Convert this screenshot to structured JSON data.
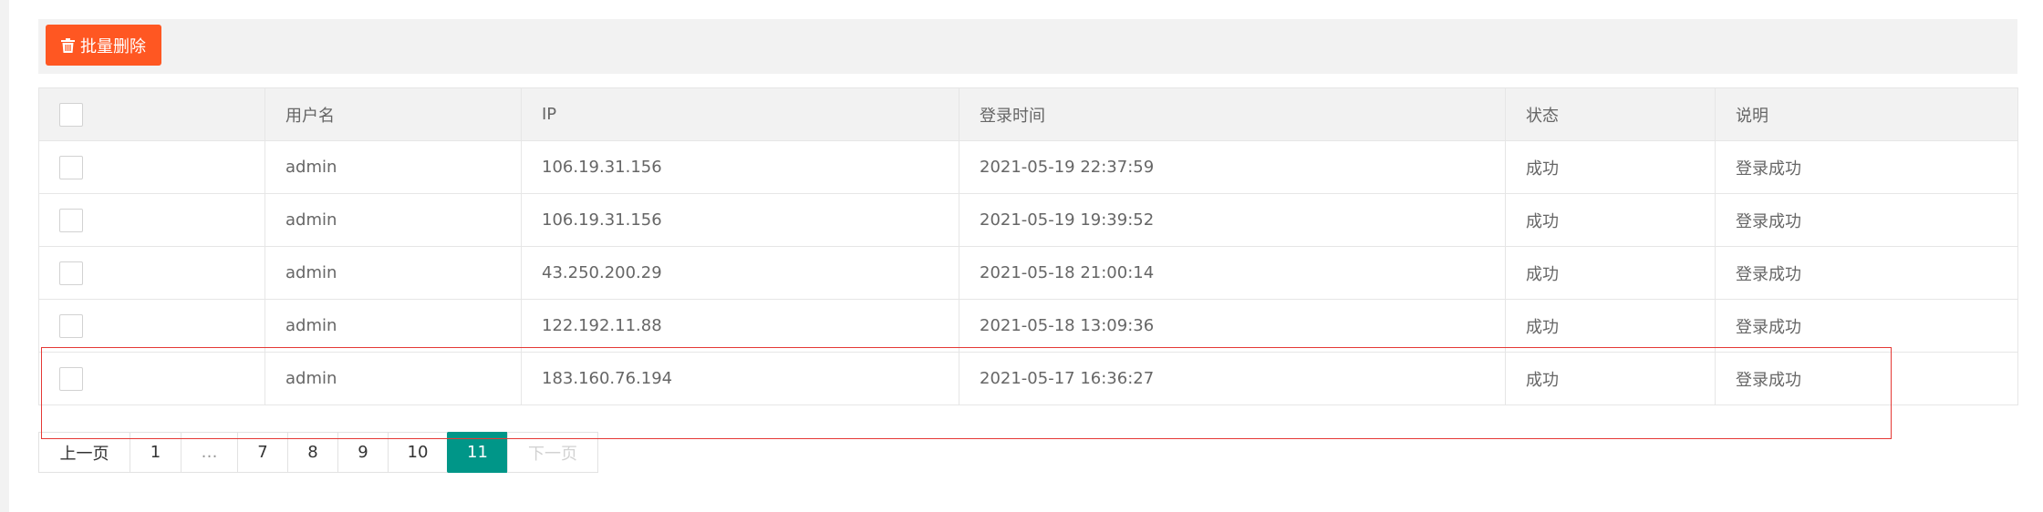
{
  "toolbar": {
    "batch_delete_label": "批量删除",
    "batch_delete_icon": "trash-icon",
    "batch_delete_color": "#ff5722"
  },
  "table": {
    "headers": [
      "用户名",
      "IP",
      "登录时间",
      "状态",
      "说明"
    ],
    "rows": [
      {
        "username": "admin",
        "ip": "106.19.31.156",
        "login_time": "2021-05-19 22:37:59",
        "status": "成功",
        "description": "登录成功"
      },
      {
        "username": "admin",
        "ip": "106.19.31.156",
        "login_time": "2021-05-19 19:39:52",
        "status": "成功",
        "description": "登录成功"
      },
      {
        "username": "admin",
        "ip": "43.250.200.29",
        "login_time": "2021-05-18 21:00:14",
        "status": "成功",
        "description": "登录成功"
      },
      {
        "username": "admin",
        "ip": "122.192.11.88",
        "login_time": "2021-05-18 13:09:36",
        "status": "成功",
        "description": "登录成功"
      },
      {
        "username": "admin",
        "ip": "183.160.76.194",
        "login_time": "2021-05-17 16:36:27",
        "status": "成功",
        "description": "登录成功"
      }
    ]
  },
  "pagination": {
    "prev_label": "上一页",
    "first_page": "1",
    "ellipsis": "…",
    "pages": [
      "7",
      "8",
      "9",
      "10"
    ],
    "current_page": "11",
    "next_label": "下一页",
    "current_color": "#009688"
  },
  "highlight_color": "#e53935"
}
